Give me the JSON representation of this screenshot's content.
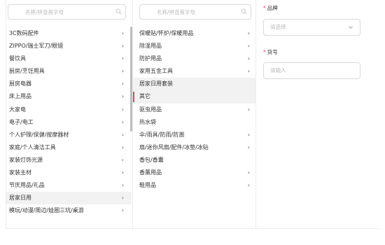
{
  "category_col1": {
    "search_placeholder": "名称/拼音首字母",
    "items": [
      {
        "label": "3C数码配件",
        "chevron": "›"
      },
      {
        "label": "ZIPPO/瑞士军刀/眼镜",
        "chevron": "›"
      },
      {
        "label": "餐饮具",
        "chevron": "›"
      },
      {
        "label": "厨房/烹饪用具",
        "chevron": "›"
      },
      {
        "label": "厨房电器",
        "chevron": "›"
      },
      {
        "label": "床上用品",
        "chevron": "›"
      },
      {
        "label": "大家电",
        "chevron": "›"
      },
      {
        "label": "电子/电工",
        "chevron": "›"
      },
      {
        "label": "个人护理/保健/按摩器材",
        "chevron": "›"
      },
      {
        "label": "家庭/个人清洁工具",
        "chevron": "›"
      },
      {
        "label": "家装灯饰光源",
        "chevron": "›"
      },
      {
        "label": "家装主材",
        "chevron": "›"
      },
      {
        "label": "节庆用品/礼品",
        "chevron": "›"
      },
      {
        "label": "居家日用",
        "chevron": "›"
      },
      {
        "label": "模玩/动漫/周边/娃圈三坑/桌游",
        "chevron": "›"
      }
    ]
  },
  "category_col2": {
    "search_placeholder": "名称/拼音首字母",
    "items": [
      {
        "label": "保暖贴/怀炉/保暖用品",
        "chevron": "›"
      },
      {
        "label": "除湿用品",
        "chevron": "›"
      },
      {
        "label": "防护用品",
        "chevron": "›"
      },
      {
        "label": "家用五金工具",
        "chevron": "›"
      },
      {
        "label": "居家日用套装",
        "chevron": ""
      },
      {
        "label": "其它",
        "chevron": ""
      },
      {
        "label": "驱虫用品",
        "chevron": "›"
      },
      {
        "label": "热水袋",
        "chevron": ""
      },
      {
        "label": "伞/雨具/防雨/防潮",
        "chevron": "›"
      },
      {
        "label": "扇/迷你风扇/配件/冰垫/冰贴",
        "chevron": "›"
      },
      {
        "label": "香包/香囊",
        "chevron": ""
      },
      {
        "label": "香薰用品",
        "chevron": "›"
      },
      {
        "label": "鞋用品",
        "chevron": "›"
      }
    ]
  },
  "attributes": {
    "brand": {
      "required_mark": "*",
      "label": "品牌",
      "placeholder": "请选择"
    },
    "model": {
      "required_mark": "*",
      "label": "货号",
      "placeholder": "请输入"
    }
  },
  "colors": {
    "accent": "#e0436b",
    "selected_bg": "#f2f2f2",
    "border": "#d9d9d9"
  },
  "state": {
    "active_col1_index": 13,
    "hover_col2_index": 4,
    "selected_col2_index": 5
  },
  "icons": {
    "search": "search-icon",
    "dropdown": "chevron-down-icon",
    "submenu": "chevron-right-icon"
  }
}
